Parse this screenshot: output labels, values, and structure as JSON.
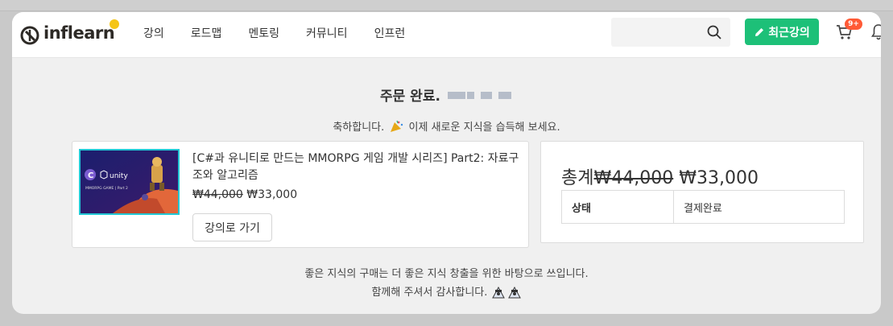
{
  "header": {
    "logo_text": "inflearn",
    "nav": [
      "강의",
      "로드맵",
      "멘토링",
      "커뮤니티",
      "인프런"
    ],
    "search": {
      "placeholder": ""
    },
    "recent_button": "최근강의",
    "cart_badge": "9+"
  },
  "order": {
    "title": "주문 완료.",
    "congrats_before": "축하합니다.",
    "congrats_after": "이제 새로운 지식을 습득해 보세요."
  },
  "course": {
    "title": "[C#과 유니티로 만드는 MMORPG 게임 개발 시리즈] Part2: 자료구조와 알고리즘",
    "original_price": "₩44,000",
    "sale_price": "₩33,000",
    "go_button": "강의로 가기",
    "thumb": {
      "brand": "unity",
      "caption": "MMORPG GAME | Part 2"
    }
  },
  "summary": {
    "total_label": "총계",
    "original_total": "₩44,000",
    "final_total": "₩33,000",
    "status_label": "상태",
    "status_value": "결제완료"
  },
  "footer": {
    "line1": "좋은 지식의 구매는 더 좋은 지식 창출을 위한 바탕으로 쓰입니다.",
    "line2": "함께해 주셔서 감사합니다."
  },
  "colors": {
    "accent": "#1dc078",
    "badge": "#ff5a36",
    "thumb_border": "#22c7d4"
  }
}
